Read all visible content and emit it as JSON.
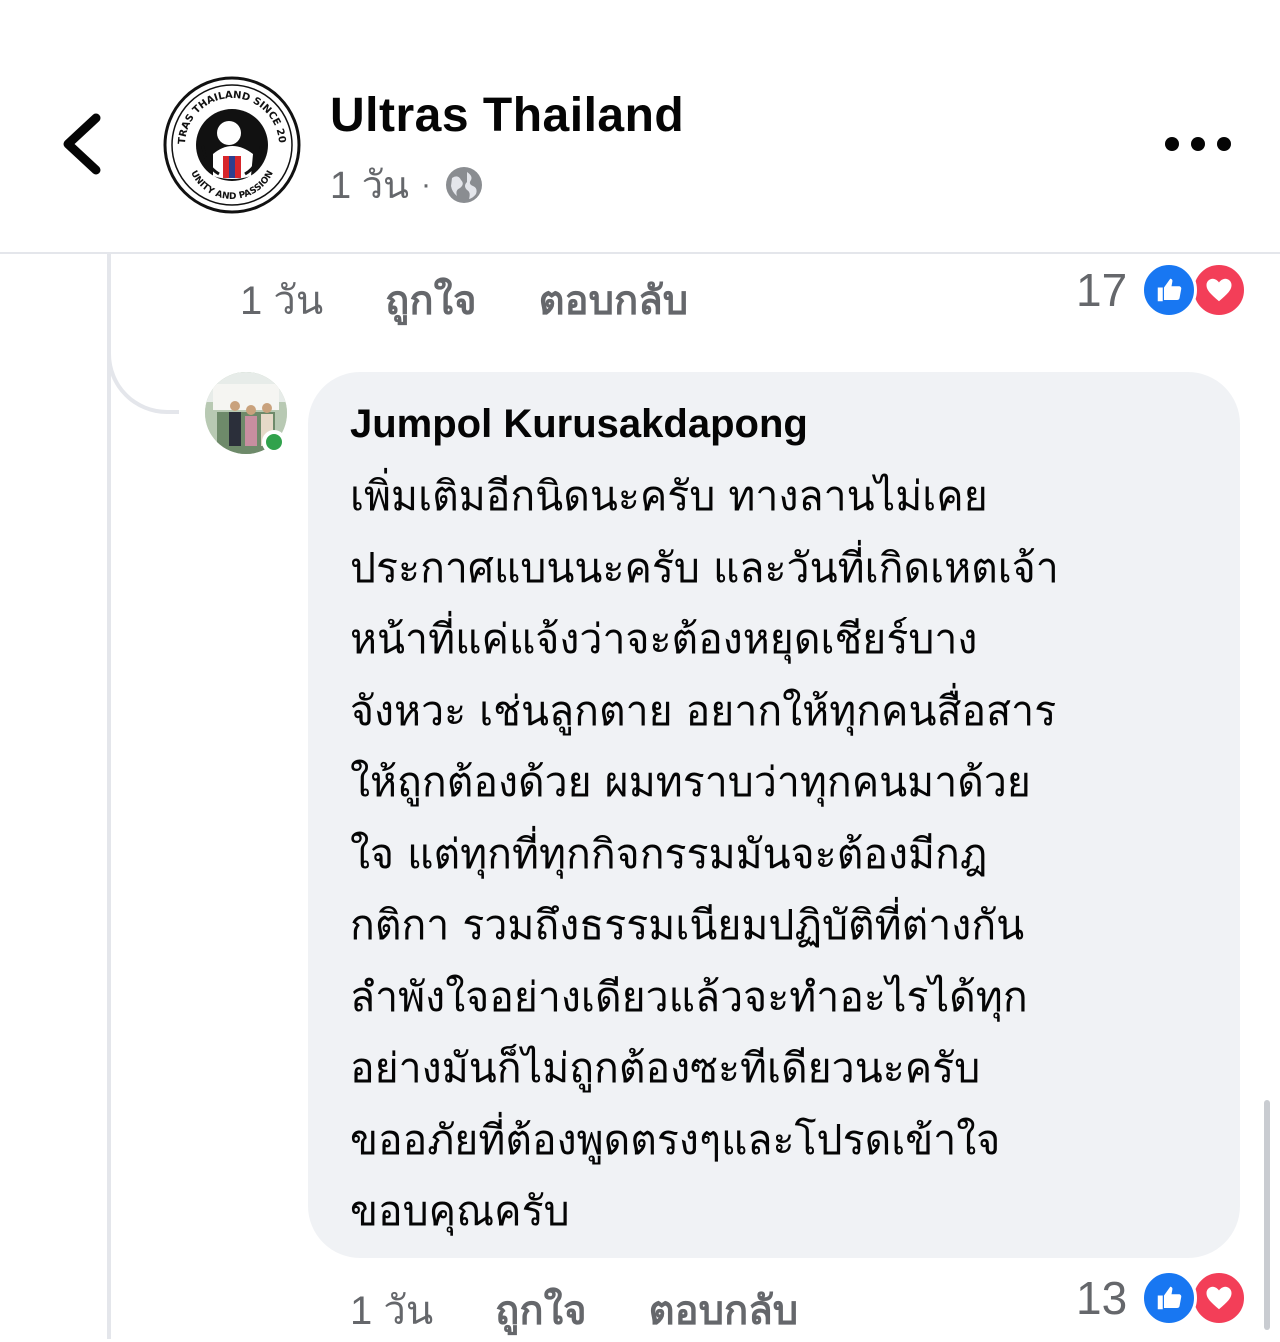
{
  "header": {
    "page_name": "Ultras Thailand",
    "time": "1 วัน",
    "separator": "·",
    "logo_text_top": "ULTRAS THAILAND SINCE 2012",
    "logo_text_bottom": "UNITY AND PASSION"
  },
  "previous_comment": {
    "time": "1 วัน",
    "like_label": "ถูกใจ",
    "reply_label": "ตอบกลับ",
    "reaction_count": "17"
  },
  "reply": {
    "author": "Jumpol Kurusakdapong",
    "lines": [
      "เพิ่มเติมอีกนิดนะครับ ทางลานไม่เคย",
      "ประกาศแบนนะครับ และวันที่เกิดเหตเจ้า",
      "หน้าที่แค่แจ้งว่าจะต้องหยุดเชียร์บาง",
      "จังหวะ  เช่นลูกตาย อยากให้ทุกคนสื่อสาร",
      "ให้ถูกต้องด้วย ผมทราบว่าทุกคนมาด้วย",
      "ใจ แต่ทุกที่ทุกกิจกรรมมันจะต้องมีกฎ",
      "กติกา รวมถึงธรรมเนียมปฏิบัติที่ต่างกัน",
      "ลำพังใจอย่างเดียวแล้วจะทำอะไรได้ทุก",
      "อย่างมันก็ไม่ถูกต้องซะทีเดียวนะครับ",
      "ขออภัยที่ต้องพูดตรงๆและโปรดเข้าใจ",
      "ขอบคุณครับ"
    ],
    "time": "1 วัน",
    "like_label": "ถูกใจ",
    "reply_label": "ตอบกลับ",
    "reaction_count": "13"
  },
  "colors": {
    "like": "#1877f2",
    "love": "#f33e58",
    "muted_text": "#65676b",
    "bubble": "#f0f2f5",
    "online": "#31a24c"
  },
  "icons": {
    "back": "chevron-left-icon",
    "privacy": "globe-icon",
    "more": "more-horizontal-icon",
    "like": "thumbs-up-icon",
    "love": "heart-icon"
  }
}
